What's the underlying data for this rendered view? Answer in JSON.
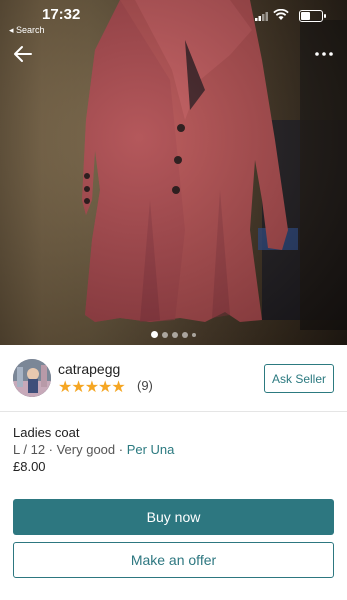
{
  "status_bar": {
    "time": "17:32",
    "back_app": "◂ Search"
  },
  "listing": {
    "image_alt": "Ladies coat photo",
    "carousel": {
      "count": 5,
      "active": 0
    }
  },
  "seller": {
    "username": "catrapegg",
    "stars": "★★★★★",
    "review_count": "(9)",
    "ask_label": "Ask Seller"
  },
  "item": {
    "title": "Ladies coat",
    "size_condition": "L / 12 · Very good · ",
    "brand": "Per Una",
    "price": "£8.00"
  },
  "actions": {
    "buy_label": "Buy now",
    "offer_label": "Make an offer"
  },
  "colors": {
    "accent": "#2d7780",
    "star": "#f5a623"
  }
}
